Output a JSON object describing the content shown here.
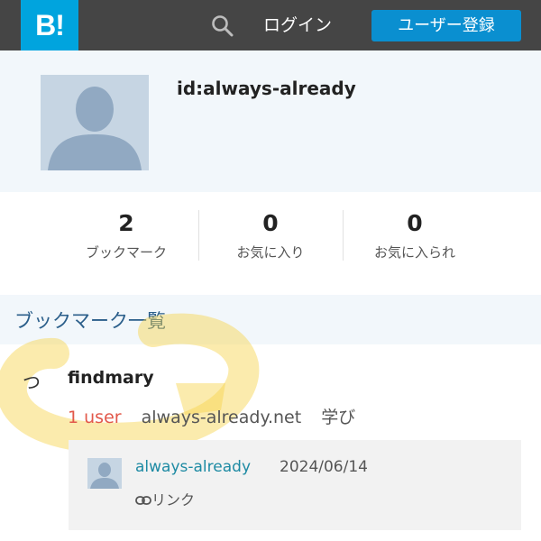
{
  "header": {
    "logo": "B!",
    "search_icon": "search-icon",
    "login_label": "ログイン",
    "signup_label": "ユーザー登録",
    "bg_color": "#454545",
    "brand_color": "#00a4de"
  },
  "profile": {
    "avatar_icon": "user-avatar-icon",
    "user_id": "id:always-already"
  },
  "stats": [
    {
      "count": "2",
      "label": "ブックマーク"
    },
    {
      "count": "0",
      "label": "お気に入り"
    },
    {
      "count": "0",
      "label": "お気に入られ"
    }
  ],
  "section": {
    "title": "ブックマーク一覧"
  },
  "entry": {
    "icon": "つ",
    "title": "findmary",
    "users": "1 user",
    "domain": "always-already.net",
    "category": "学び"
  },
  "comment": {
    "avatar_icon": "user-avatar-icon",
    "user": "always-already",
    "date": "2024/06/14",
    "link_icon": "link-icon",
    "link_label": "リンク"
  },
  "highlight_color": "#f7d34a"
}
